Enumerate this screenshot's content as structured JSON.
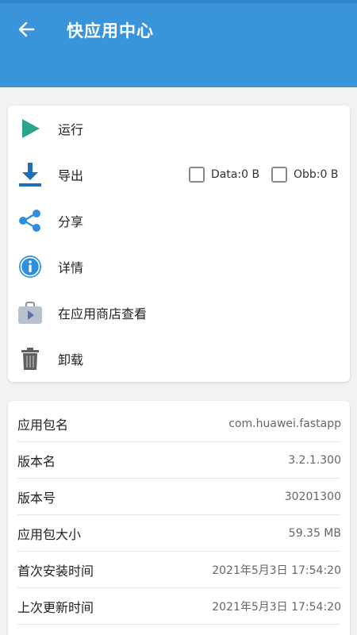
{
  "header": {
    "title": "快应用中心",
    "back_icon": "arrow-left-icon",
    "color": "#3a94d9"
  },
  "actions": {
    "items": [
      {
        "label": "运行",
        "icon": "play-icon"
      },
      {
        "label": "导出",
        "icon": "download-icon"
      },
      {
        "label": "分享",
        "icon": "share-icon"
      },
      {
        "label": "详情",
        "icon": "info-icon"
      },
      {
        "label": "在应用商店查看",
        "icon": "store-bag-icon"
      },
      {
        "label": "卸载",
        "icon": "trash-icon"
      }
    ],
    "export_options": {
      "data_label": "Data:0 B",
      "data_checked": false,
      "obb_label": "Obb:0 B",
      "obb_checked": false
    }
  },
  "info": {
    "rows": [
      {
        "key": "应用包名",
        "value": "com.huawei.fastapp"
      },
      {
        "key": "版本名",
        "value": "3.2.1.300"
      },
      {
        "key": "版本号",
        "value": "30201300"
      },
      {
        "key": "应用包大小",
        "value": "59.35 MB"
      },
      {
        "key": "首次安装时间",
        "value": "2021年5月3日 17:54:20"
      },
      {
        "key": "上次更新时间",
        "value": "2021年5月3日 17:54:20"
      }
    ]
  },
  "colors": {
    "accent": "#3a94d9",
    "play": "#2aa58c",
    "download": "#1e6fb8",
    "share": "#2e8fe0",
    "info": "#2e8fe0",
    "trash": "#5f5f5f"
  }
}
